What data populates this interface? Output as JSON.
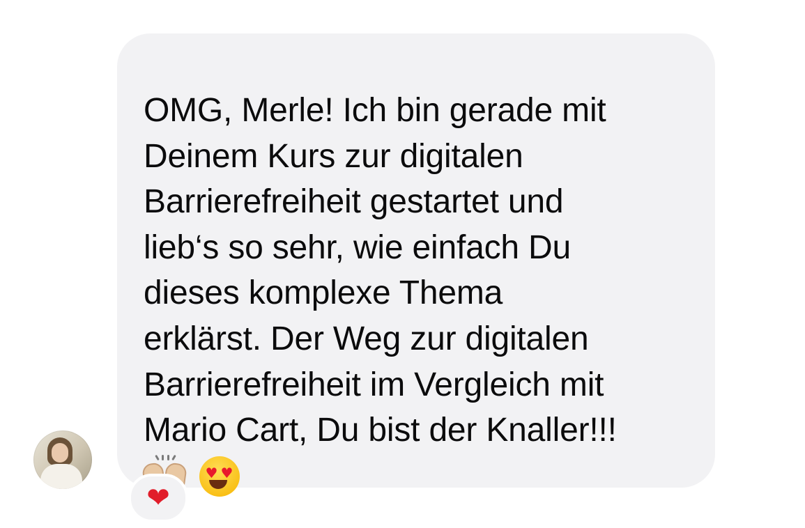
{
  "message": {
    "lines": [
      "OMG, Merle! Ich bin gerade mit",
      "Deinem Kurs zur digitalen",
      "Barrierefreiheit gestartet und",
      "lieb‘s so sehr, wie einfach Du",
      "dieses komplexe Thema",
      "erklärst. Der Weg zur digitalen",
      "Barrierefreiheit im Vergleich mit",
      "Mario Cart, Du bist der Knaller!!!"
    ],
    "emojis": [
      "raised-hands-icon",
      "heart-eyes-face-icon"
    ],
    "bubble_color": "#f2f2f4",
    "text_color": "#0b0b0c"
  },
  "sender": {
    "avatar_icon": "profile-photo"
  },
  "reaction": {
    "emoji": "❤",
    "icon": "red-heart-icon",
    "color": "#e11d2a"
  },
  "eyes_glyph": "♥"
}
